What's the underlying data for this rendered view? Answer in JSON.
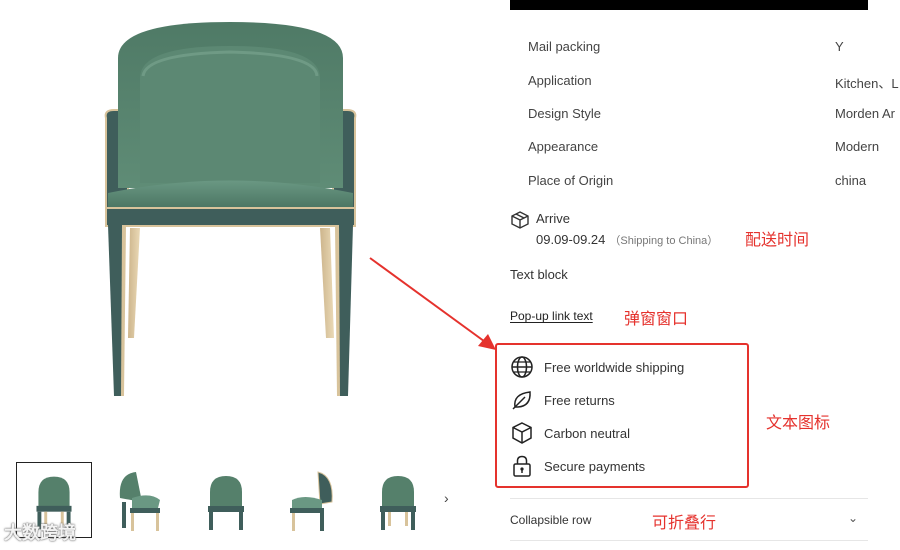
{
  "specs": [
    {
      "label": "Mail packing",
      "value": "Y"
    },
    {
      "label": "Application",
      "value": "Kitchen、L"
    },
    {
      "label": "Design Style",
      "value": "Morden Ar"
    },
    {
      "label": "Appearance",
      "value": "Modern"
    },
    {
      "label": "Place of Origin",
      "value": "china"
    }
  ],
  "arrive": {
    "title": "Arrive",
    "dates": "09.09-09.24",
    "note": "（Shipping to China）"
  },
  "text_block": "Text block",
  "popup_link": "Pop-up link text",
  "features": [
    {
      "label": "Free worldwide shipping",
      "icon": "globe-icon"
    },
    {
      "label": "Free returns",
      "icon": "leaf-icon"
    },
    {
      "label": "Carbon neutral",
      "icon": "box-icon"
    },
    {
      "label": "Secure payments",
      "icon": "lock-icon"
    }
  ],
  "collapsible": {
    "label": "Collapsible row",
    "icon": "chevron-down-icon"
  },
  "annotations": {
    "delivery_time": "配送时间",
    "popup_window": "弹窗窗口",
    "text_icons": "文本图标",
    "collapsible_row": "可折叠行"
  },
  "thumbnail_next": "›",
  "watermark": "大数跨境",
  "colors": {
    "accent_red": "#e5322d",
    "chair_green": "#55806b",
    "leg_gold": "#d8c39b",
    "base_teal": "#3f5e5b"
  }
}
